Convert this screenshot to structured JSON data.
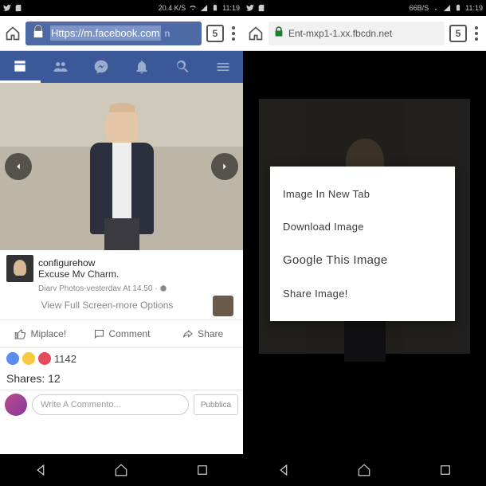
{
  "left": {
    "status": {
      "speed": "20.4 K/S",
      "time": "11:19"
    },
    "browser": {
      "url": "Https://m.facebook.com",
      "url_tail": "n",
      "tab_count": "5"
    },
    "post": {
      "author": "configurehow",
      "caption": "Excuse Mv Charm.",
      "meta": "Diarv Photos-vesterdav At 14.50 ·",
      "full_link": "View Full Screen-more Options"
    },
    "actions": {
      "like": "Miplace!",
      "comment": "Comment",
      "share": "Share"
    },
    "reactions": {
      "count": "1142"
    },
    "shares_label": "Shares:",
    "shares_value": "12",
    "comment": {
      "placeholder": "Write A Commento...",
      "publish": "Pubblica"
    }
  },
  "right": {
    "status": {
      "speed": "66B/S",
      "time": "11:19"
    },
    "browser": {
      "url": "Ent-mxp1-1.xx.fbcdn.net",
      "tab_count": "5"
    },
    "context_menu": {
      "items": [
        "Image In New Tab",
        "Download Image",
        "Google This Image",
        "Share Image!"
      ]
    }
  }
}
